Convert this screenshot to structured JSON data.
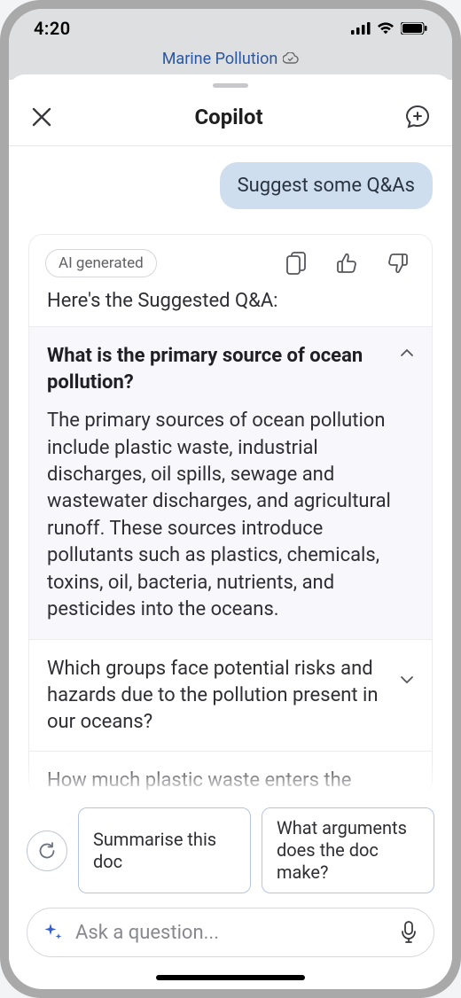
{
  "status": {
    "time": "4:20"
  },
  "doc": {
    "title": "Marine Pollution"
  },
  "sheet": {
    "title": "Copilot"
  },
  "chat": {
    "user_prompt": "Suggest some Q&As",
    "ai_tag": "AI generated",
    "intro": "Here's the Suggested Q&A:",
    "qa": [
      {
        "q": "What is the primary source of ocean pollution?",
        "a": "The primary sources of ocean pollution include plastic waste, industrial discharges, oil spills, sewage and wastewater discharges, and agricultural runoff. These sources introduce pollutants such as plastics, chemicals, toxins, oil, bacteria, nutrients, and pesticides into the oceans.",
        "expanded": true
      },
      {
        "q": "Which groups face potential risks and hazards due to the pollution present in our oceans?",
        "expanded": false
      },
      {
        "q": "How much plastic waste enters the",
        "expanded": false
      }
    ]
  },
  "suggestions": [
    "Summarise this doc",
    "What arguments does the doc make?"
  ],
  "input": {
    "placeholder": "Ask a question..."
  }
}
